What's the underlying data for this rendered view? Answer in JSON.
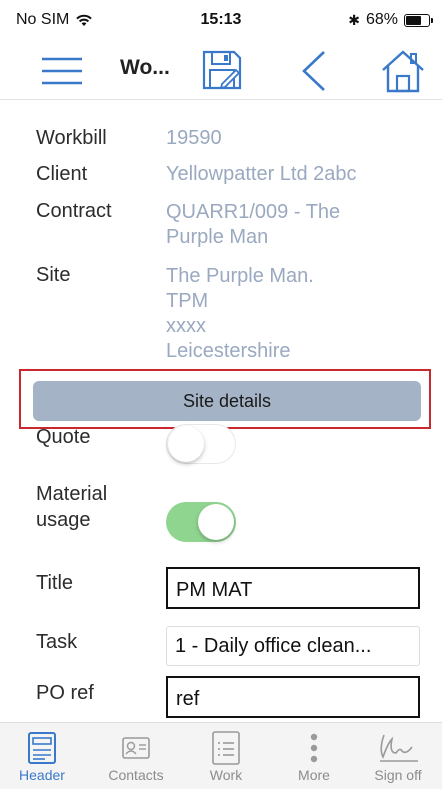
{
  "status_bar": {
    "carrier": "No SIM",
    "time": "15:13",
    "bluetooth": "✱",
    "battery_percent": "68%",
    "battery_level": 0.68
  },
  "nav": {
    "title": "Wo...",
    "icons": [
      "menu-icon",
      "save-icon",
      "back-icon",
      "home-icon"
    ],
    "accent": "#3a79c9"
  },
  "fields": {
    "workbill_label": "Workbill",
    "workbill_value": "19590",
    "client_label": "Client",
    "client_value": "Yellowpatter Ltd 2abc",
    "contract_label": "Contract",
    "contract_value": [
      "QUARR1/009 - The",
      "Purple Man"
    ],
    "site_label": "Site",
    "site_value": [
      "The Purple Man.",
      "TPM",
      "xxxx",
      "Leicestershire"
    ],
    "site_details_button": "Site details",
    "quote_label": "Quote",
    "quote_on": false,
    "material_label": [
      "Material",
      "usage"
    ],
    "material_on": true,
    "title_label": "Title",
    "title_value": "PM  MAT",
    "task_label": "Task",
    "task_value": "1 - Daily office clean...",
    "po_label": "PO ref",
    "po_value": "ref"
  },
  "tabs": [
    {
      "label": "Header",
      "icon": "header-icon",
      "active": true
    },
    {
      "label": "Contacts",
      "icon": "contacts-icon",
      "active": false
    },
    {
      "label": "Work",
      "icon": "work-icon",
      "active": false
    },
    {
      "label": "More",
      "icon": "more-icon",
      "active": false
    },
    {
      "label": "Sign off",
      "icon": "signature-icon",
      "active": false
    }
  ],
  "colors": {
    "value_text": "#9aa9c0",
    "button_bg": "#a5b3c6",
    "highlight_border": "#c8282e",
    "toggle_on": "#8fd590"
  }
}
